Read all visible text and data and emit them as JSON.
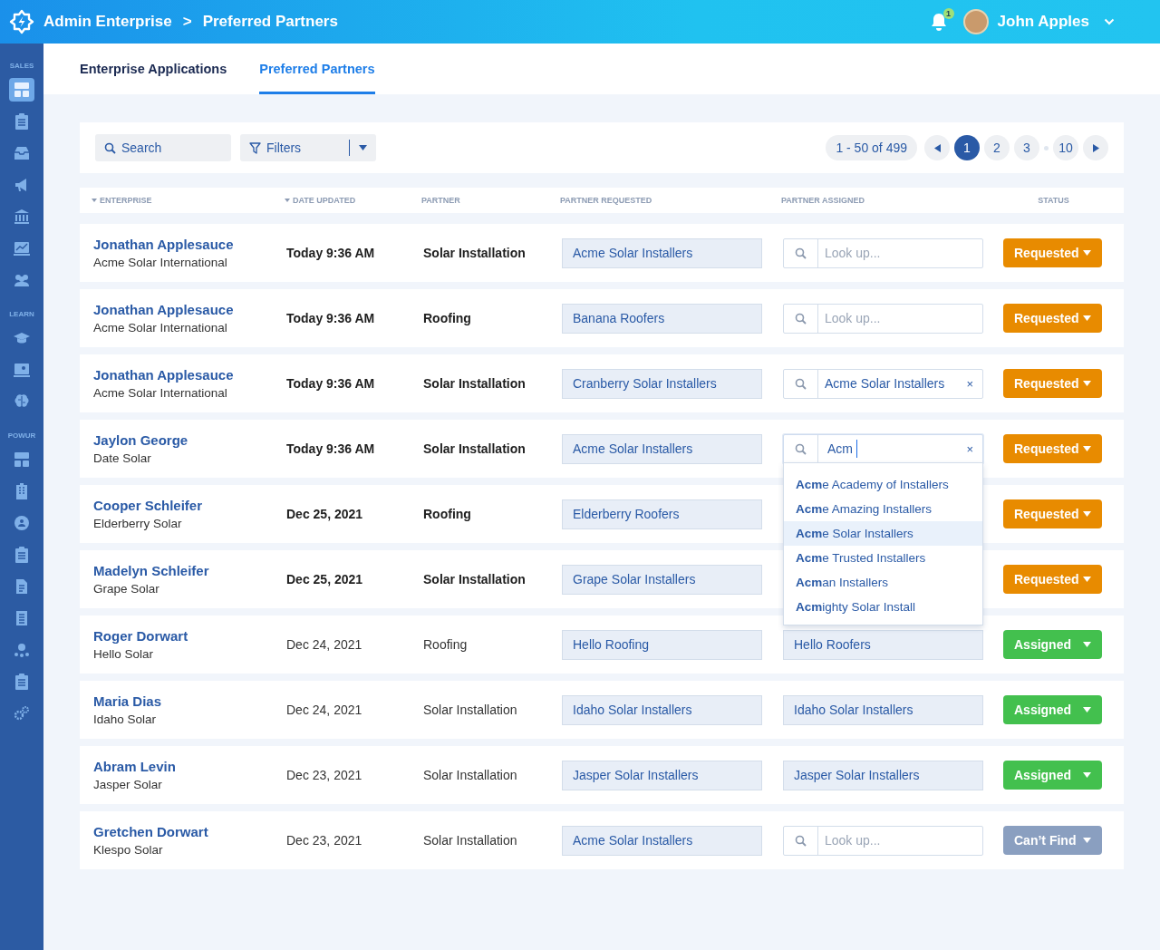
{
  "header": {
    "breadcrumbs": [
      "Admin Enterprise",
      "Preferred Partners"
    ],
    "separator": ">",
    "notifications": "1",
    "user": "John Apples"
  },
  "sidebar": {
    "sections": [
      {
        "label": "SALES",
        "items": [
          {
            "selected": true
          },
          {
            "selected": false
          },
          {
            "selected": false
          },
          {
            "selected": false
          },
          {
            "selected": false
          },
          {
            "selected": false
          },
          {
            "selected": false
          }
        ]
      },
      {
        "label": "LEARN",
        "items": [
          {
            "selected": false
          },
          {
            "selected": false
          },
          {
            "selected": false
          }
        ]
      },
      {
        "label": "POWUR",
        "items": [
          {
            "selected": false
          },
          {
            "selected": false
          },
          {
            "selected": false
          },
          {
            "selected": false
          },
          {
            "selected": false
          },
          {
            "selected": false
          },
          {
            "selected": false
          },
          {
            "selected": false
          },
          {
            "selected": false
          }
        ]
      }
    ]
  },
  "tabs": [
    {
      "label": "Enterprise Applications",
      "selected": false
    },
    {
      "label": "Preferred Partners",
      "selected": true
    }
  ],
  "toolbar": {
    "search": {
      "placeholder": "Search"
    },
    "filters": "Filters",
    "range": "1 - 50 of 499",
    "pages": [
      {
        "label": "1",
        "selected": true
      },
      {
        "label": "2",
        "selected": false
      },
      {
        "label": "3",
        "selected": false
      },
      {
        "label": "10",
        "selected": false
      }
    ]
  },
  "table": {
    "columns": [
      {
        "label": "ENTERPRISE",
        "sorted": true
      },
      {
        "label": "DATE UPDATED",
        "sorted": true
      },
      {
        "label": "PARTNER",
        "sorted": false
      },
      {
        "label": "PARTNER REQUESTED",
        "sorted": false
      },
      {
        "label": "PARTNER ASSIGNED",
        "sorted": false
      },
      {
        "label": "STATUS",
        "sorted": false
      }
    ],
    "rows": [
      {
        "name": "Jonathan Applesauce",
        "company": "Acme Solar International",
        "date": "Today  9:36 AM",
        "recent": true,
        "partner": "Solar Installation",
        "requested": "Acme Solar Installers",
        "assigned": {
          "kind": "lookup",
          "placeholder": "Look up...",
          "focused": false
        },
        "status": {
          "kind": "requested",
          "label": "Requested"
        }
      },
      {
        "name": "Jonathan Applesauce",
        "company": "Acme Solar International",
        "date": "Today  9:36 AM",
        "recent": true,
        "partner": "Roofing",
        "requested": "Banana Roofers",
        "assigned": {
          "kind": "lookup",
          "placeholder": "Look up...",
          "focused": false
        },
        "status": {
          "kind": "requested",
          "label": "Requested"
        }
      },
      {
        "name": "Jonathan Applesauce",
        "company": "Acme Solar International",
        "date": "Today  9:36 AM",
        "recent": true,
        "partner": "Solar Installation",
        "requested": "Cranberry Solar Installers",
        "assigned": {
          "kind": "search",
          "value": "Acme Solar Installers",
          "clear": "×",
          "focused": false
        },
        "status": {
          "kind": "requested",
          "label": "Requested"
        }
      },
      {
        "name": "Jaylon George",
        "company": "Date Solar",
        "date": "Today  9:36 AM",
        "recent": true,
        "partner": "Solar Installation",
        "requested": "Acme Solar Installers",
        "assigned": {
          "kind": "search",
          "value": "Acm",
          "clear": "×",
          "focused": true,
          "options": [
            {
              "label": "**Acm**e Academy of Installers",
              "selected": false
            },
            {
              "label": "**Acm**e Amazing Installers",
              "selected": false
            },
            {
              "label": "**Acm**e Solar Installers",
              "selected": true
            },
            {
              "label": "**Acm**e Trusted Installers",
              "selected": false
            },
            {
              "label": "**Acm**an Installers",
              "selected": false
            },
            {
              "label": "**Acm**ighty Solar Install",
              "selected": false
            }
          ]
        },
        "status": {
          "kind": "requested",
          "label": "Requested"
        }
      },
      {
        "name": "Cooper Schleifer",
        "company": "Elderberry Solar",
        "date": "Dec 25, 2021",
        "recent": true,
        "partner": "Roofing",
        "requested": "Elderberry Roofers",
        "assigned": {
          "kind": "hidden"
        },
        "status": {
          "kind": "requested",
          "label": "Requested"
        }
      },
      {
        "name": "Madelyn Schleifer",
        "company": "Grape Solar",
        "date": "Dec 25, 2021",
        "recent": true,
        "partner": "Solar Installation",
        "requested": "Grape Solar Installers",
        "assigned": {
          "kind": "hidden"
        },
        "status": {
          "kind": "requested",
          "label": "Requested"
        }
      },
      {
        "name": "Roger Dorwart",
        "company": "Hello Solar",
        "date": "Dec 24, 2021",
        "recent": false,
        "partner": "Roofing",
        "requested": "Hello Roofing",
        "assigned": {
          "kind": "value",
          "value": "Hello Roofers"
        },
        "status": {
          "kind": "assigned",
          "label": "Assigned"
        }
      },
      {
        "name": "Maria Dias",
        "company": "Idaho Solar",
        "date": "Dec 24, 2021",
        "recent": false,
        "partner": "Solar Installation",
        "requested": "Idaho Solar Installers",
        "assigned": {
          "kind": "value",
          "value": "Idaho Solar Installers"
        },
        "status": {
          "kind": "assigned",
          "label": "Assigned"
        }
      },
      {
        "name": "Abram Levin",
        "company": "Jasper Solar",
        "date": "Dec 23, 2021",
        "recent": false,
        "partner": "Solar Installation",
        "requested": "Jasper Solar Installers",
        "assigned": {
          "kind": "value",
          "value": "Jasper Solar Installers"
        },
        "status": {
          "kind": "assigned",
          "label": "Assigned"
        }
      },
      {
        "name": "Gretchen Dorwart",
        "company": "Klespo Solar",
        "date": "Dec 23, 2021",
        "recent": false,
        "partner": "Solar Installation",
        "requested": "Acme Solar Installers",
        "assigned": {
          "kind": "lookup",
          "placeholder": "Look up...",
          "focused": false
        },
        "status": {
          "kind": "cant_find",
          "label": "Can’t Find"
        }
      }
    ]
  }
}
